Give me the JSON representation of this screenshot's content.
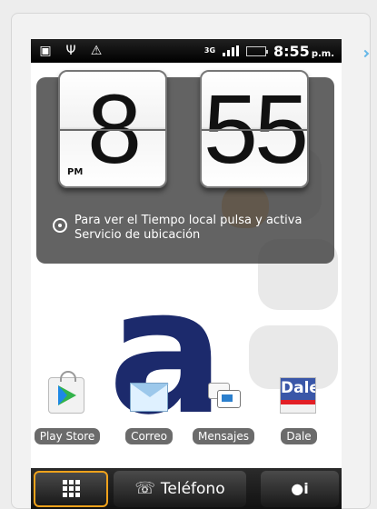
{
  "status_bar": {
    "network": "3G",
    "time": "8:55",
    "ampm": "p.m.",
    "icons": [
      "gallery-icon",
      "usb-icon",
      "warning-icon"
    ]
  },
  "clock": {
    "hour": "8",
    "minutes": "55",
    "period": "PM",
    "message": "Para ver el Tiempo local pulsa y activa Servicio de ubicación"
  },
  "apps": [
    {
      "label": "Play Store",
      "icon": "play-store-icon"
    },
    {
      "label": "Correo",
      "icon": "mail-icon"
    },
    {
      "label": "Mensajes",
      "icon": "messages-icon"
    },
    {
      "label": "Dale",
      "icon": "dale-icon"
    }
  ],
  "dock": {
    "phone_label": "Teléfono",
    "icons": [
      "apps-grid-icon",
      "phone-icon",
      "friend-icon"
    ]
  },
  "colors": {
    "wallpaper_brand": "#1c2a6c",
    "accent_focus": "#f0a21b",
    "battery": "#39c339"
  }
}
